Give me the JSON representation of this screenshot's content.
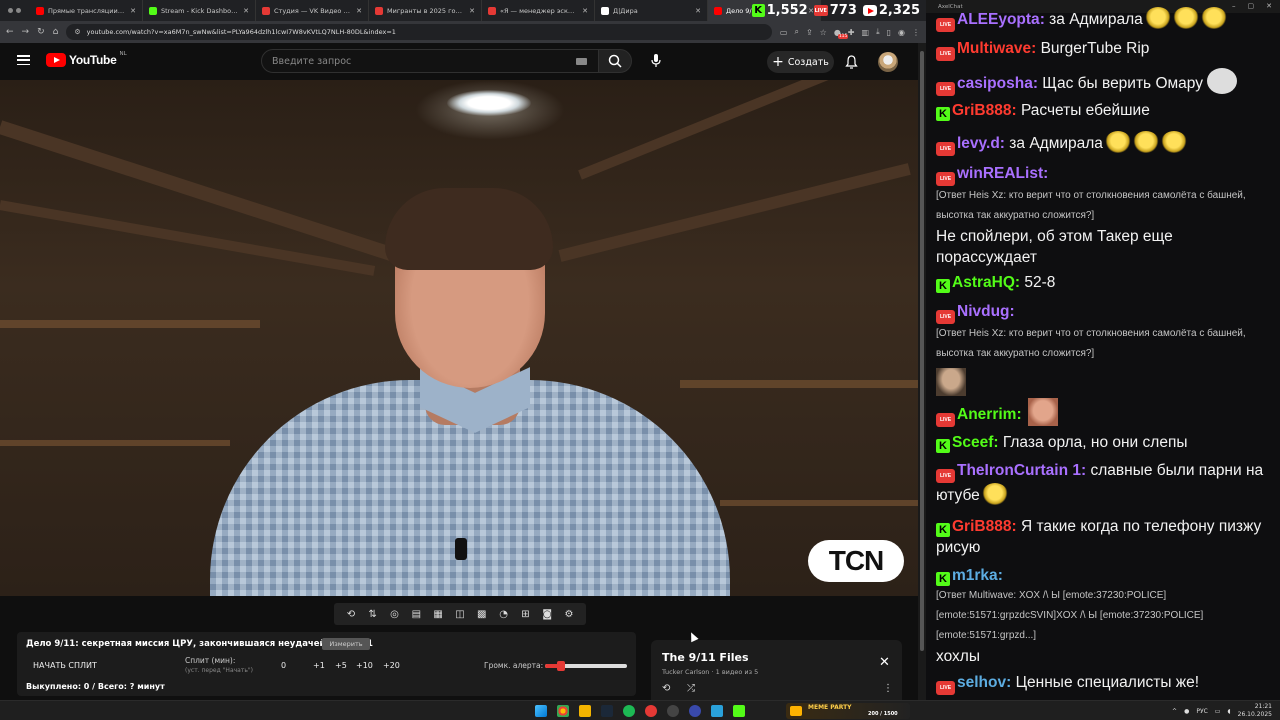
{
  "browser": {
    "tabs": [
      {
        "title": "Прямые трансляции - YouTube",
        "color": "#ff0000",
        "active": false
      },
      {
        "title": "Stream - Kick Dashboard",
        "color": "#53fc18",
        "active": false
      },
      {
        "title": "Студия — VK Видео Live",
        "color": "#e53935",
        "active": false
      },
      {
        "title": "Мигранты в 2025 году: новое",
        "color": "#e53935",
        "active": false
      },
      {
        "title": "«Я — менеджер эскортницы»",
        "color": "#e53935",
        "active": false
      },
      {
        "title": "Д|Дира",
        "color": "#ffffff",
        "active": false
      },
      {
        "title": "Дело 9/11",
        "color": "#ff0000",
        "active": true
      }
    ],
    "url": "youtube.com/watch?v=xa6M7n_swNw&list=PLYa964dzlh1lcwI7W8vKVtLQ7NLH-80DL&index=1",
    "viewer_counts": {
      "kick": "1,552",
      "vk": "773",
      "youtube": "2,325"
    },
    "extension_badge": "115"
  },
  "youtube": {
    "logo_text": "YouTube",
    "region": "NL",
    "search_placeholder": "Введите запрос",
    "create_label": "Создать"
  },
  "video": {
    "channel_logo": "TCN"
  },
  "split_panel": {
    "title": "Дело 9/11: секретная миссия ЦРУ, закончившаяся неудачей | Серия 1",
    "measure_label": "Измерить",
    "start_split": "НАЧАТЬ СПЛИТ",
    "split_label": "Сплит (мин):",
    "split_hint": "(уст. перед \"Начать\")",
    "steps": [
      "0",
      "+1",
      "+5",
      "+10",
      "+20"
    ],
    "volume_label": "Громк. алерта:",
    "volume_level": 0.2,
    "status": "Выкуплено: 0 / Всего: ? минут"
  },
  "playlist": {
    "title": "The 9/11 Files",
    "subtitle": "Tucker Carlson · 1 видео из 5"
  },
  "chat": {
    "window_title": "AxelChat",
    "messages": [
      {
        "platform": "live",
        "user": "ALEEyopta",
        "color": "#a970ff",
        "text": "за Адмирала",
        "emotes": 3
      },
      {
        "platform": "live",
        "user": "Multiwave",
        "color": "#ff3b30",
        "text": "BurgerTube Rip"
      },
      {
        "platform": "live",
        "user": "casiposha",
        "color": "#a970ff",
        "text": "Щас бы верить Омару",
        "emote_meme": true
      },
      {
        "platform": "kick",
        "user": "GriB888",
        "color": "#ff3b30",
        "text": "Расчеты ебейшие"
      },
      {
        "platform": "live",
        "user": "levy.d",
        "color": "#a970ff",
        "text": "за Адмирала",
        "emotes": 3
      },
      {
        "platform": "live",
        "user": "winREAList",
        "color": "#a970ff",
        "reply": "[Ответ Heis Xz: кто верит что от столкновения самолёта с башней, высотка так аккуратно сложится?]",
        "text": "Не спойлери, об этом Такер еще порассуждает"
      },
      {
        "platform": "kick",
        "user": "AstraHQ",
        "color": "#53fc18",
        "text": "52-8"
      },
      {
        "platform": "live",
        "user": "Nivdug",
        "color": "#a970ff",
        "reply": "[Ответ Heis Xz: кто верит что от столкновения самолёта с башней, высотка так аккуратно сложится?]",
        "avatar_img": true
      },
      {
        "platform": "live",
        "user": "Anerrim",
        "color": "#53fc18",
        "emote_face": true
      },
      {
        "platform": "kick",
        "user": "Sceef",
        "color": "#53fc18",
        "text": "Глаза орла, но они слепы"
      },
      {
        "platform": "live",
        "user": "TheIronCurtain 1",
        "color": "#a970ff",
        "text": "славные были парни на ютубе",
        "emotes": 1
      },
      {
        "platform": "kick",
        "user": "GriB888",
        "color": "#ff3b30",
        "text": "Я такие когда по телефону пизжу рисую"
      },
      {
        "platform": "kick",
        "user": "m1rka",
        "color": "#5dade2",
        "reply": "[Ответ Multiwave: XOX /\\ Ы [emote:37230:POLICE] [emote:51571:grpzdcSVIN]XOX /\\ Ы [emote:37230:POLICE] [emote:51571:grpzd...]",
        "text": "хохлы"
      },
      {
        "platform": "live",
        "user": "selhov",
        "color": "#5dade2",
        "text": "Ценные специалисты же!"
      }
    ]
  },
  "taskbar": {
    "meme_party_title": "MEME PARTY",
    "meme_party_count": "200 / 1500",
    "language": "РУС",
    "time": "21:21",
    "date": "26.10.2025"
  }
}
